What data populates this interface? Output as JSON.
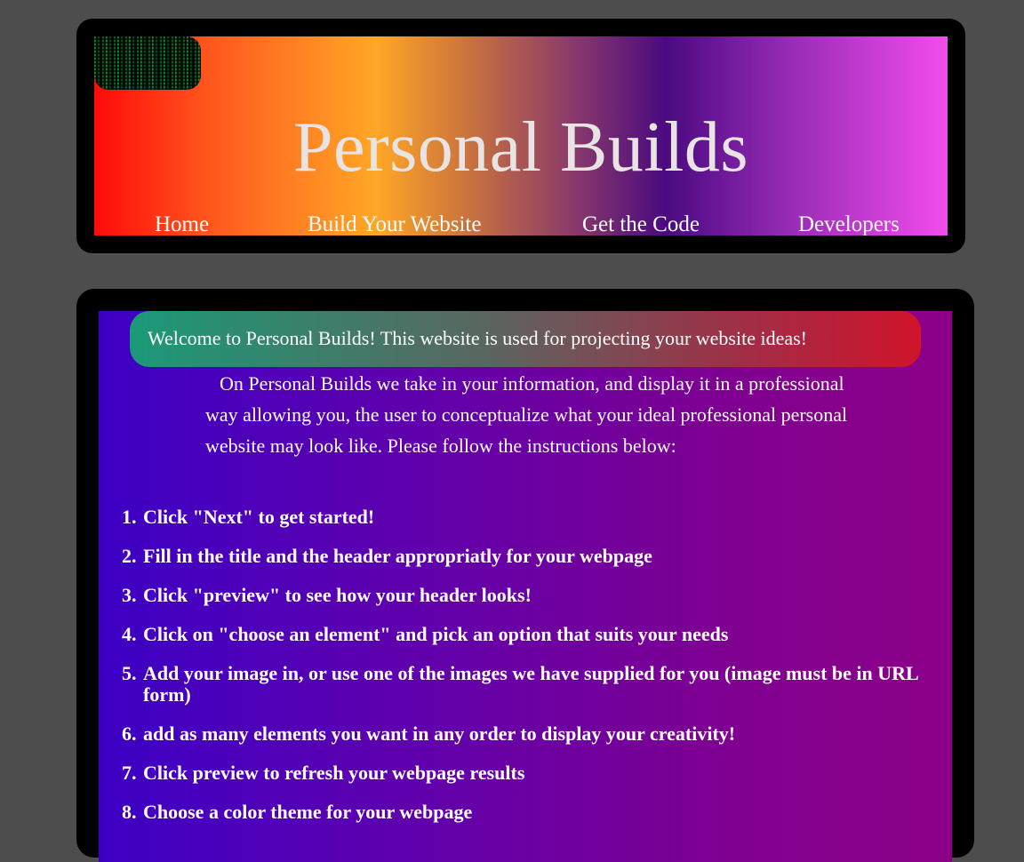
{
  "header": {
    "title": "Personal Builds",
    "logo_icon": "matrix-code-logo",
    "nav": [
      {
        "label": "Home"
      },
      {
        "label": "Build Your Website"
      },
      {
        "label": "Get the Code"
      },
      {
        "label": "Developers"
      }
    ]
  },
  "main": {
    "welcome": "Welcome to Personal Builds! This website is used for projecting your website ideas!",
    "intro": "On Personal Builds we take in your information, and display it in a professional way allowing you, the user to conceptualize what your ideal professional personal website may look like. Please follow the instructions below:",
    "steps": [
      {
        "num": "1.",
        "text": "Click \"Next\" to get started!"
      },
      {
        "num": "2.",
        "text": "Fill in the title and the header appropriatly for your webpage"
      },
      {
        "num": "3.",
        "text": "Click \"preview\" to see how your header looks!"
      },
      {
        "num": "4.",
        "text": "Click on \"choose an element\" and pick an option that suits your needs"
      },
      {
        "num": "5.",
        "text": "Add your image in, or use one of the images we have supplied for you (image must be in URL form)"
      },
      {
        "num": "6.",
        "text": "add as many elements you want in any order to display your creativity!"
      },
      {
        "num": "7.",
        "text": "Click preview to refresh your webpage results"
      },
      {
        "num": "8.",
        "text": "Choose a color theme for your webpage"
      }
    ]
  },
  "colors": {
    "page_background": "#4d4d4d",
    "frame": "#000000",
    "text": "#ffffff",
    "title": "#e8e4e4"
  }
}
